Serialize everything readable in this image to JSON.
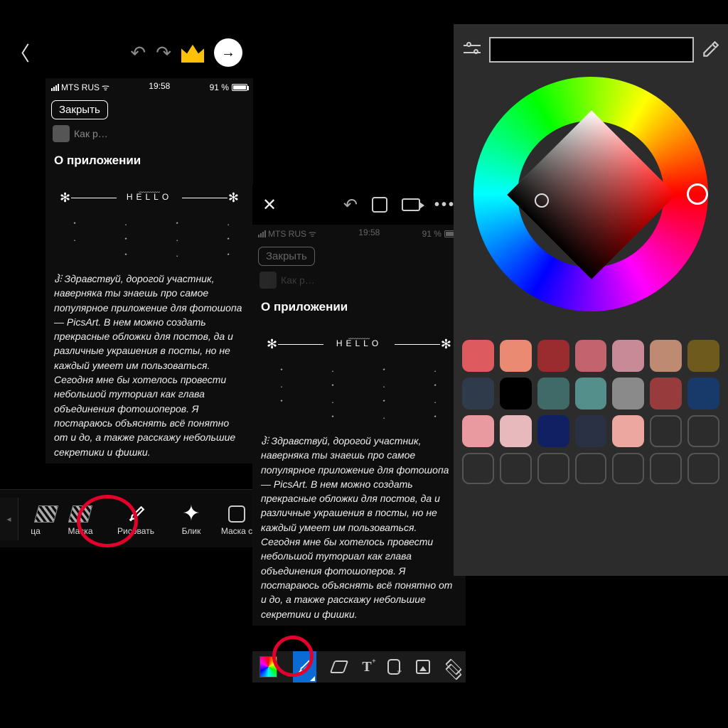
{
  "status": {
    "carrier": "MTS RUS",
    "time": "19:58",
    "battery": "91 %"
  },
  "panel1": {
    "close": "Закрыть",
    "chip_title": "Как р…",
    "section": "О приложении",
    "hello": "HELLO",
    "body": "ჰ⫶ Здравствуй, дорогой участник, наверняка ты знаешь про самое популярное приложение для фотошопа — PicsArt. В нем можно создать прекрасные обложки для постов, да и различные украшения в посты, но не каждый умеет им пользоваться. Сегодня мне бы хотелось провести небольшой туториал как глава объединения фотошоперов. Я постараюсь объяснять всё понятно от и до, а также расскажу небольшие секретики и фишки."
  },
  "toolstrip": {
    "left": "ца",
    "mask": "Маска",
    "draw": "Рисовать",
    "flare": "Блик",
    "mask2": "Маска с"
  },
  "panel2": {
    "close": "Закрыть",
    "chip_title": "Как р…",
    "section": "О приложении",
    "hello": "HELLO",
    "body": "ჰ⫶ Здравствуй, дорогой участник, наверняка ты знаешь про самое популярное приложение для фотошопа — PicsArt. В нем можно создать прекрасные обложки для постов, да и различные украшения в посты, но не каждый умеет им пользоваться. Сегодня мне бы хотелось провести небольшой туториал как глава объединения фотошоперов. Я постараюсь объяснять всё понятно от и до, а также расскажу небольшие секретики и фишки.",
    "more": "•••"
  },
  "swatches": [
    "#dd5a5f",
    "#ea8a72",
    "#9a2b2e",
    "#c2636e",
    "#c98a98",
    "#be8a72",
    "#6f5a1e",
    "#2f3a4a",
    "#000000",
    "#3f6a67",
    "#558f8c",
    "#8a8a8a",
    "#983b3d",
    "#183a6b",
    "#e99aa0",
    "#e7b8bc",
    "#102063",
    "#2a3144",
    "#eca7a0",
    "",
    ""
  ]
}
